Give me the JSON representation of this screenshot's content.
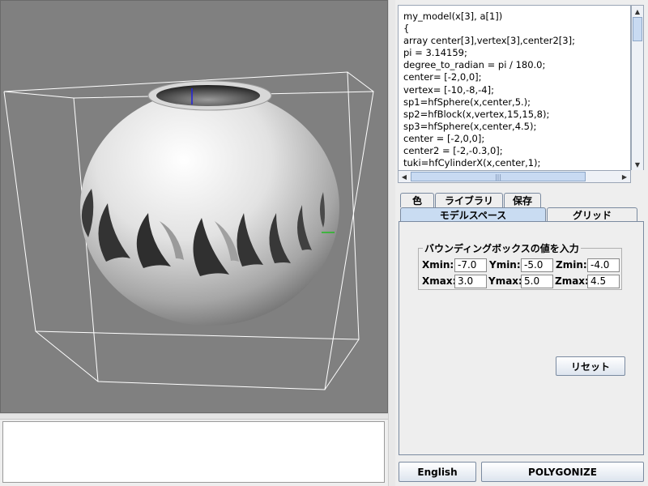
{
  "code": {
    "lines": [
      "my_model(x[3], a[1])",
      "{",
      "array center[3],vertex[3],center2[3];",
      "pi = 3.14159;",
      "degree_to_radian = pi / 180.0;",
      "center= [-2,0,0];",
      "vertex= [-10,-8,-4];",
      "sp1=hfSphere(x,center,5.);",
      "sp2=hfBlock(x,vertex,15,15,8);",
      "sp3=hfSphere(x,center,4.5);",
      "center = [-2,0,0];",
      "center2 = [-2,-0.3,0];",
      "tuki=hfCylinderX(x,center,1);"
    ]
  },
  "tabs_top": [
    {
      "label": "色"
    },
    {
      "label": "ライブラリ"
    },
    {
      "label": "保存"
    }
  ],
  "tabs_bottom": [
    {
      "label": "モデルスペース",
      "selected": true
    },
    {
      "label": "グリッド",
      "selected": false
    }
  ],
  "bounding_box": {
    "title": "バウンディングボックスの値を入力",
    "xmin_label": "Xmin:",
    "xmin": "-7.0",
    "ymin_label": "Ymin:",
    "ymin": "-5.0",
    "zmin_label": "Zmin:",
    "zmin": "-4.0",
    "xmax_label": "Xmax:",
    "xmax": "3.0",
    "ymax_label": "Ymax:",
    "ymax": "5.0",
    "zmax_label": "Zmax:",
    "zmax": "4.5"
  },
  "buttons": {
    "reset": "リセット",
    "english": "English",
    "polygonize": "POLYGONIZE"
  },
  "colors": {
    "viewport_bg": "#808080",
    "selected_tab": "#c9dcf2",
    "axis_y": "#2222dd",
    "axis_x": "#22bb22"
  }
}
